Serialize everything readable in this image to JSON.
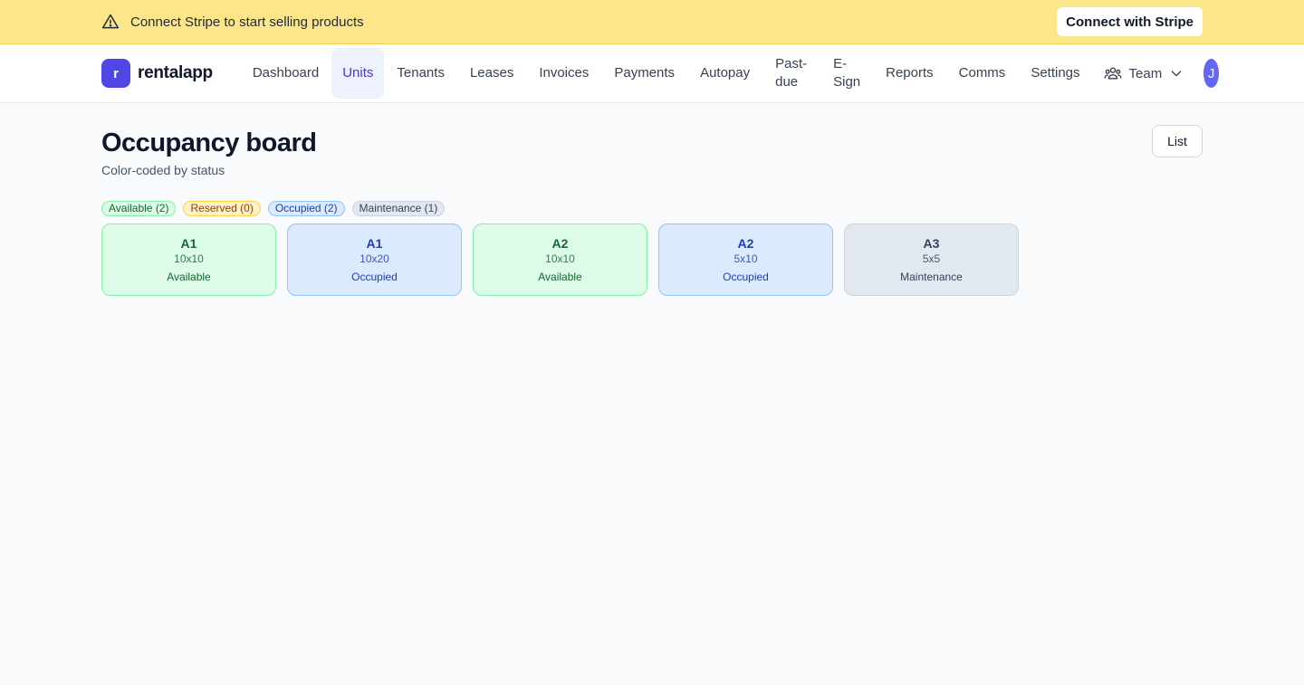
{
  "banner": {
    "message": "Connect Stripe to start selling products",
    "button_label": "Connect with Stripe",
    "icon": "warning-triangle-icon"
  },
  "nav": {
    "brand_initial": "r",
    "brand_name": "rentalapp",
    "links": [
      {
        "label": "Dashboard"
      },
      {
        "label": "Units",
        "active": true
      },
      {
        "label": "Tenants"
      },
      {
        "label": "Leases"
      },
      {
        "label": "Invoices"
      },
      {
        "label": "Payments"
      },
      {
        "label": "Autopay"
      },
      {
        "label": "Past-due"
      },
      {
        "label": "E-Sign"
      },
      {
        "label": "Reports"
      },
      {
        "label": "Comms"
      },
      {
        "label": "Settings"
      }
    ],
    "team_label": "Team",
    "avatar_initial": "J"
  },
  "page": {
    "title": "Occupancy board",
    "subtitle": "Color-coded by status",
    "list_button": "List"
  },
  "legend": [
    {
      "label": "Available (2)",
      "status": "available"
    },
    {
      "label": "Reserved (0)",
      "status": "reserved"
    },
    {
      "label": "Occupied (2)",
      "status": "occupied"
    },
    {
      "label": "Maintenance (1)",
      "status": "maintenance"
    }
  ],
  "units": [
    {
      "name": "A1",
      "size": "10x10",
      "status": "Available"
    },
    {
      "name": "A1",
      "size": "10x20",
      "status": "Occupied"
    },
    {
      "name": "A2",
      "size": "10x10",
      "status": "Available"
    },
    {
      "name": "A2",
      "size": "5x10",
      "status": "Occupied"
    },
    {
      "name": "A3",
      "size": "5x5",
      "status": "Maintenance"
    }
  ],
  "colors": {
    "banner_bg": "#fde68a",
    "brand": "#4f46e5",
    "available": "#dcfce7",
    "reserved": "#fef3c7",
    "occupied": "#dbeafe",
    "maintenance": "#e2e8f0"
  }
}
